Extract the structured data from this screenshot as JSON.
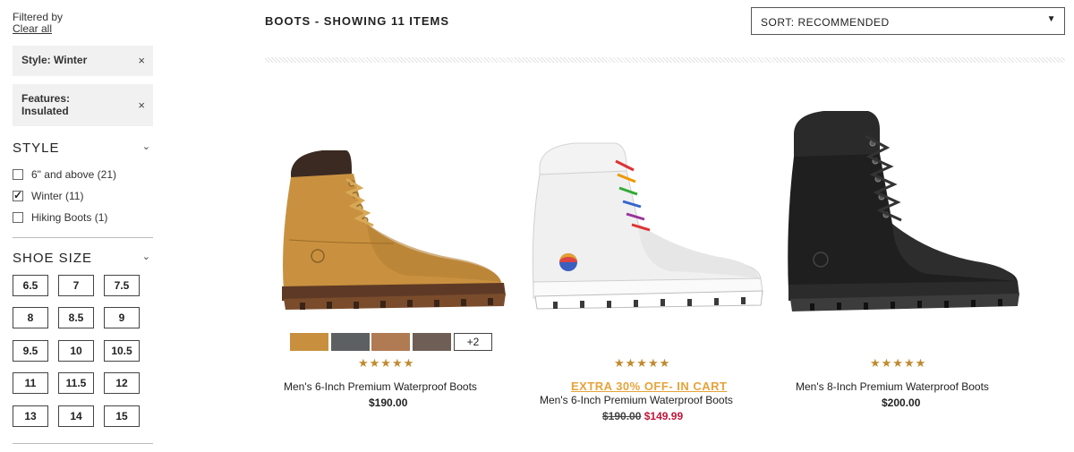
{
  "filters": {
    "filtered_by": "Filtered by",
    "clear_all": "Clear all",
    "active": [
      {
        "label": "Style: Winter",
        "remove": "×"
      },
      {
        "label_line1": "Features:",
        "label_line2": "Insulated",
        "remove": "×"
      }
    ]
  },
  "style_section": {
    "title": "STYLE",
    "chevron": "chevron-down-icon",
    "options": [
      {
        "label": "6\" and above (21)",
        "checked": false
      },
      {
        "label": "Winter (11)",
        "checked": true
      },
      {
        "label": "Hiking Boots (1)",
        "checked": false
      }
    ]
  },
  "shoe_size_section": {
    "title": "SHOE SIZE",
    "chevron": "chevron-down-icon",
    "sizes": [
      "6.5",
      "7",
      "7.5",
      "8",
      "8.5",
      "9",
      "9.5",
      "10",
      "10.5",
      "11",
      "11.5",
      "12",
      "13",
      "14",
      "15"
    ]
  },
  "header": {
    "category": "BOOTS",
    "showing": " - SHOWING 11 ITEMS",
    "sort_label": "SORT: RECOMMENDED",
    "sort_caret": "▼"
  },
  "products": [
    {
      "name": "Men's 6-Inch Premium Waterproof Boots",
      "price": "$190.00",
      "stars": "★★★★★",
      "rating": 4.5,
      "color": "wheat",
      "swatches": [
        "#c8903e",
        "#5c6063",
        "#b07a52",
        "#6e5e55"
      ],
      "more_swatches": "+2"
    },
    {
      "name": "Men's 6-Inch Premium Waterproof Boots",
      "promo": "EXTRA 30% OFF- IN CART",
      "old_price": "$190.00",
      "sale_price": "$149.99",
      "stars": "★★★★★",
      "rating": 4.5,
      "color": "white"
    },
    {
      "name": "Men's 8-Inch Premium Waterproof Boots",
      "price": "$200.00",
      "stars": "★★★★★",
      "rating": 4.5,
      "color": "black"
    }
  ]
}
